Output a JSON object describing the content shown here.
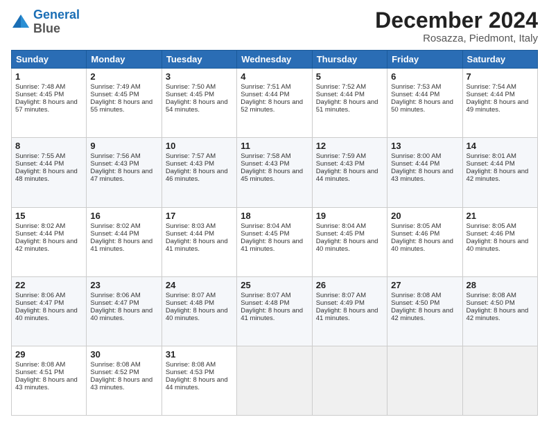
{
  "header": {
    "logo_line1": "General",
    "logo_line2": "Blue",
    "month": "December 2024",
    "location": "Rosazza, Piedmont, Italy"
  },
  "weekdays": [
    "Sunday",
    "Monday",
    "Tuesday",
    "Wednesday",
    "Thursday",
    "Friday",
    "Saturday"
  ],
  "weeks": [
    [
      {
        "day": "1",
        "sunrise": "7:48 AM",
        "sunset": "4:45 PM",
        "daylight": "8 hours and 57 minutes."
      },
      {
        "day": "2",
        "sunrise": "7:49 AM",
        "sunset": "4:45 PM",
        "daylight": "8 hours and 55 minutes."
      },
      {
        "day": "3",
        "sunrise": "7:50 AM",
        "sunset": "4:45 PM",
        "daylight": "8 hours and 54 minutes."
      },
      {
        "day": "4",
        "sunrise": "7:51 AM",
        "sunset": "4:44 PM",
        "daylight": "8 hours and 52 minutes."
      },
      {
        "day": "5",
        "sunrise": "7:52 AM",
        "sunset": "4:44 PM",
        "daylight": "8 hours and 51 minutes."
      },
      {
        "day": "6",
        "sunrise": "7:53 AM",
        "sunset": "4:44 PM",
        "daylight": "8 hours and 50 minutes."
      },
      {
        "day": "7",
        "sunrise": "7:54 AM",
        "sunset": "4:44 PM",
        "daylight": "8 hours and 49 minutes."
      }
    ],
    [
      {
        "day": "8",
        "sunrise": "7:55 AM",
        "sunset": "4:44 PM",
        "daylight": "8 hours and 48 minutes."
      },
      {
        "day": "9",
        "sunrise": "7:56 AM",
        "sunset": "4:43 PM",
        "daylight": "8 hours and 47 minutes."
      },
      {
        "day": "10",
        "sunrise": "7:57 AM",
        "sunset": "4:43 PM",
        "daylight": "8 hours and 46 minutes."
      },
      {
        "day": "11",
        "sunrise": "7:58 AM",
        "sunset": "4:43 PM",
        "daylight": "8 hours and 45 minutes."
      },
      {
        "day": "12",
        "sunrise": "7:59 AM",
        "sunset": "4:43 PM",
        "daylight": "8 hours and 44 minutes."
      },
      {
        "day": "13",
        "sunrise": "8:00 AM",
        "sunset": "4:44 PM",
        "daylight": "8 hours and 43 minutes."
      },
      {
        "day": "14",
        "sunrise": "8:01 AM",
        "sunset": "4:44 PM",
        "daylight": "8 hours and 42 minutes."
      }
    ],
    [
      {
        "day": "15",
        "sunrise": "8:02 AM",
        "sunset": "4:44 PM",
        "daylight": "8 hours and 42 minutes."
      },
      {
        "day": "16",
        "sunrise": "8:02 AM",
        "sunset": "4:44 PM",
        "daylight": "8 hours and 41 minutes."
      },
      {
        "day": "17",
        "sunrise": "8:03 AM",
        "sunset": "4:44 PM",
        "daylight": "8 hours and 41 minutes."
      },
      {
        "day": "18",
        "sunrise": "8:04 AM",
        "sunset": "4:45 PM",
        "daylight": "8 hours and 41 minutes."
      },
      {
        "day": "19",
        "sunrise": "8:04 AM",
        "sunset": "4:45 PM",
        "daylight": "8 hours and 40 minutes."
      },
      {
        "day": "20",
        "sunrise": "8:05 AM",
        "sunset": "4:46 PM",
        "daylight": "8 hours and 40 minutes."
      },
      {
        "day": "21",
        "sunrise": "8:05 AM",
        "sunset": "4:46 PM",
        "daylight": "8 hours and 40 minutes."
      }
    ],
    [
      {
        "day": "22",
        "sunrise": "8:06 AM",
        "sunset": "4:47 PM",
        "daylight": "8 hours and 40 minutes."
      },
      {
        "day": "23",
        "sunrise": "8:06 AM",
        "sunset": "4:47 PM",
        "daylight": "8 hours and 40 minutes."
      },
      {
        "day": "24",
        "sunrise": "8:07 AM",
        "sunset": "4:48 PM",
        "daylight": "8 hours and 40 minutes."
      },
      {
        "day": "25",
        "sunrise": "8:07 AM",
        "sunset": "4:48 PM",
        "daylight": "8 hours and 41 minutes."
      },
      {
        "day": "26",
        "sunrise": "8:07 AM",
        "sunset": "4:49 PM",
        "daylight": "8 hours and 41 minutes."
      },
      {
        "day": "27",
        "sunrise": "8:08 AM",
        "sunset": "4:50 PM",
        "daylight": "8 hours and 42 minutes."
      },
      {
        "day": "28",
        "sunrise": "8:08 AM",
        "sunset": "4:50 PM",
        "daylight": "8 hours and 42 minutes."
      }
    ],
    [
      {
        "day": "29",
        "sunrise": "8:08 AM",
        "sunset": "4:51 PM",
        "daylight": "8 hours and 43 minutes."
      },
      {
        "day": "30",
        "sunrise": "8:08 AM",
        "sunset": "4:52 PM",
        "daylight": "8 hours and 43 minutes."
      },
      {
        "day": "31",
        "sunrise": "8:08 AM",
        "sunset": "4:53 PM",
        "daylight": "8 hours and 44 minutes."
      },
      null,
      null,
      null,
      null
    ]
  ]
}
